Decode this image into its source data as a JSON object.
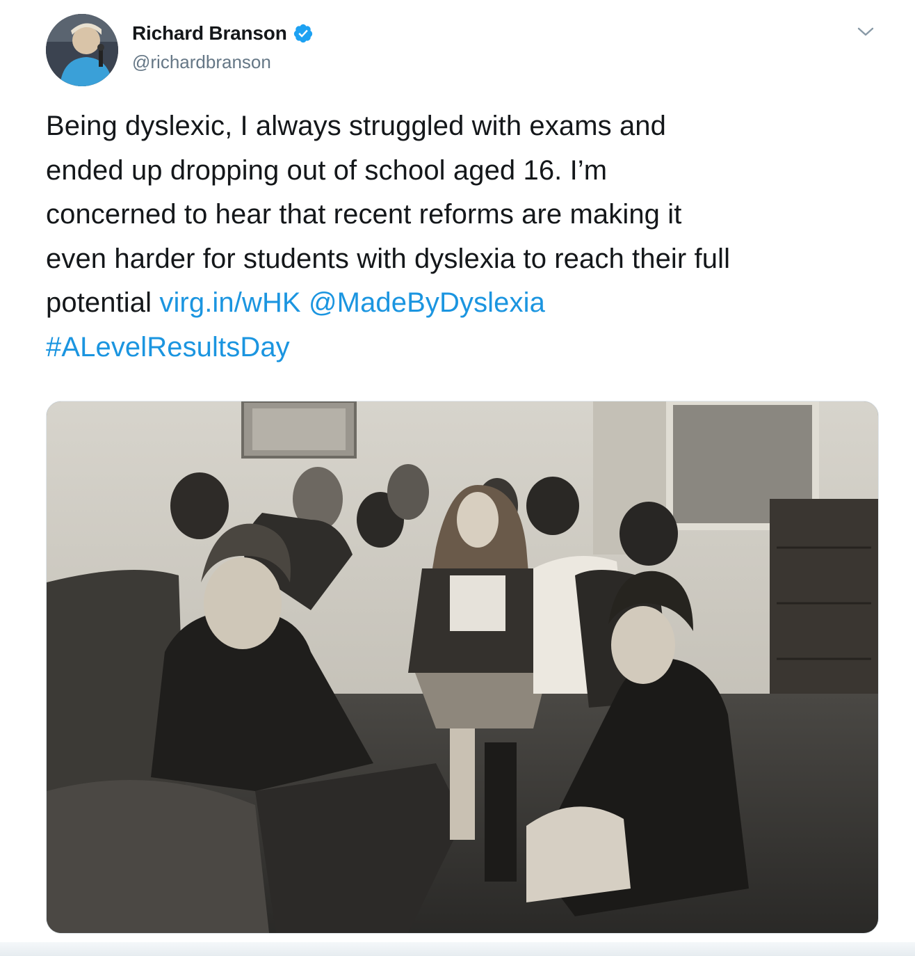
{
  "tweet": {
    "author": {
      "display_name": "Richard Branson",
      "handle": "@richardbranson",
      "verified": true,
      "avatar_icon": "profile-photo"
    },
    "text_lines": [
      "Being dyslexic, I always struggled with exams and",
      "ended up dropping out of school aged 16. I’m",
      "concerned to hear that recent reforms are making it",
      "even harder for students with dyslexia to reach their full"
    ],
    "last_line_prefix": "potential ",
    "link": "virg.in/wHK",
    "mention": "@MadeByDyslexia",
    "hashtag": "#ALevelResultsDay",
    "media": {
      "type": "photo",
      "style": "black-and-white"
    },
    "menu_icon": "chevron-down-icon",
    "colors": {
      "link": "#1b95e0",
      "verified": "#1da1f2",
      "text": "#14171a",
      "secondary": "#657786"
    }
  }
}
